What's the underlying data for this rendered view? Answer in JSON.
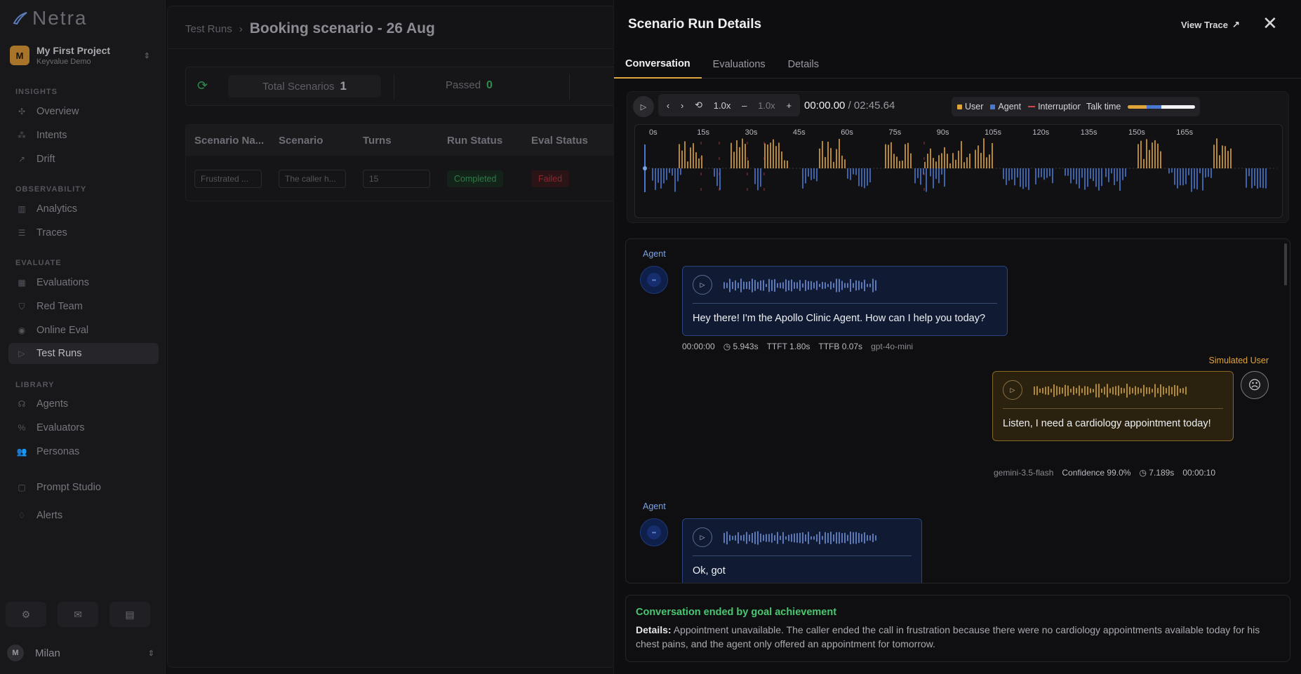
{
  "app": {
    "logo": "Netra"
  },
  "project": {
    "initial": "M",
    "name": "My First Project",
    "sub": "Keyvalue Demo"
  },
  "sidebar": {
    "sections": [
      {
        "label": "INSIGHTS",
        "items": [
          {
            "label": "Overview",
            "icon": "overview-icon"
          },
          {
            "label": "Intents",
            "icon": "intents-icon"
          },
          {
            "label": "Drift",
            "icon": "drift-icon"
          }
        ]
      },
      {
        "label": "OBSERVABILITY",
        "items": [
          {
            "label": "Analytics",
            "icon": "analytics-icon"
          },
          {
            "label": "Traces",
            "icon": "traces-icon"
          }
        ]
      },
      {
        "label": "EVALUATE",
        "items": [
          {
            "label": "Evaluations",
            "icon": "evaluations-icon"
          },
          {
            "label": "Red Team",
            "icon": "shield-icon"
          },
          {
            "label": "Online Eval",
            "icon": "broadcast-icon"
          },
          {
            "label": "Test Runs",
            "icon": "play-icon",
            "active": true
          }
        ]
      },
      {
        "label": "LIBRARY",
        "items": [
          {
            "label": "Agents",
            "icon": "agents-icon"
          },
          {
            "label": "Evaluators",
            "icon": "percent-icon"
          },
          {
            "label": "Personas",
            "icon": "users-icon"
          }
        ]
      }
    ],
    "extra": [
      {
        "label": "Prompt Studio",
        "icon": "chat-icon"
      },
      {
        "label": "Alerts",
        "icon": "bell-icon"
      }
    ],
    "user": {
      "initial": "M",
      "name": "Milan"
    }
  },
  "main": {
    "breadcrumb": {
      "parent": "Test Runs",
      "current": "Booking scenario - 26 Aug"
    },
    "stats": {
      "total_label": "Total Scenarios",
      "total_value": "1",
      "passed_label": "Passed",
      "passed_value": "0"
    },
    "table": {
      "headers": [
        "Scenario Na...",
        "Scenario",
        "Turns",
        "Run Status",
        "Eval Status"
      ],
      "row": {
        "name": "Frustrated ...",
        "scenario": "The caller h...",
        "turns": "15",
        "run_status": "Completed",
        "eval_status": "Failed"
      }
    }
  },
  "drawer": {
    "title": "Scenario Run Details",
    "view_trace": "View Trace",
    "tabs": [
      "Conversation",
      "Evaluations",
      "Details"
    ],
    "player": {
      "speed": "1.0x",
      "speed_dim": "1.0x",
      "current_time": "00:00.00",
      "separator": "/",
      "total_time": "02:45.64",
      "legend": {
        "user": "User",
        "agent": "Agent",
        "interruption": "Interruption"
      },
      "talk_time_label": "Talk time",
      "talk_time": {
        "user": 0.28,
        "agent": 0.22,
        "silence": 0.5
      },
      "ticks": [
        "0s",
        "15s",
        "30s",
        "45s",
        "60s",
        "75s",
        "90s",
        "105s",
        "120s",
        "135s",
        "150s",
        "165s"
      ]
    },
    "colors": {
      "user": "#e0a53a",
      "agent": "#4a78d0",
      "interruption": "#d04a4a",
      "success": "#4ac770"
    },
    "messages": [
      {
        "role": "Agent",
        "text": "Hey there! I'm the Apollo Clinic Agent. How can I help you today?",
        "meta": {
          "timestamp": "00:00:00",
          "duration": "5.943s",
          "ttft": "TTFT 1.80s",
          "ttfb": "TTFB 0.07s",
          "model": "gpt-4o-mini"
        }
      },
      {
        "role": "Simulated User",
        "text": "Listen, I need a cardiology appointment today!",
        "meta": {
          "model": "gemini-3.5-flash",
          "confidence": "Confidence 99.0%",
          "duration": "7.189s",
          "timestamp": "00:00:10"
        }
      },
      {
        "role": "Agent",
        "text": "Ok, got"
      }
    ],
    "end": {
      "title": "Conversation ended by goal achievement",
      "details_label": "Details:",
      "details": "Appointment unavailable. The caller ended the call in frustration because there were no cardiology appointments available today for his chest pains, and the agent only offered an appointment for tomorrow."
    }
  }
}
